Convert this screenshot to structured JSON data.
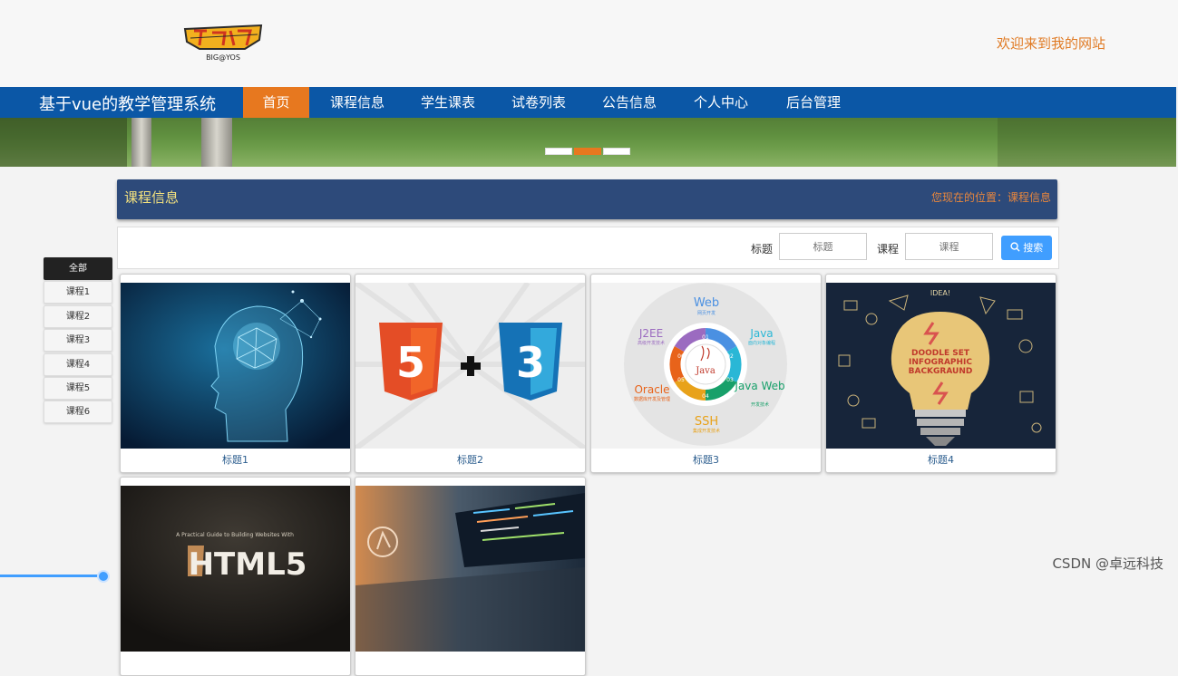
{
  "header": {
    "logo_text": "BIG@YOS",
    "welcome": "欢迎来到我的网站"
  },
  "navbar": {
    "site_title": "基于vue的教学管理系统",
    "items": [
      "首页",
      "课程信息",
      "学生课表",
      "试卷列表",
      "公告信息",
      "个人中心",
      "后台管理"
    ],
    "active_index": 0
  },
  "banner": {
    "slide_count": 3,
    "active_slide": 2
  },
  "panel": {
    "title": "课程信息",
    "breadcrumb": "您现在的位置：课程信息"
  },
  "search": {
    "title_label": "标题",
    "title_placeholder": "标题",
    "course_label": "课程",
    "course_placeholder": "课程",
    "button_label": "搜索"
  },
  "categories": [
    "全部",
    "课程1",
    "课程2",
    "课程3",
    "课程4",
    "课程5",
    "课程6"
  ],
  "cards": [
    {
      "caption": "标题1",
      "image": "ai-brain-head"
    },
    {
      "caption": "标题2",
      "image": "html5-plus-css3"
    },
    {
      "caption": "标题3",
      "image": "java-wheel"
    },
    {
      "caption": "标题4",
      "image": "lightbulb-infographic"
    },
    {
      "caption": "",
      "image": "html5-book"
    },
    {
      "caption": "",
      "image": "laptop-code"
    }
  ],
  "card_texts": {
    "doodle": [
      "DOODLE SET",
      "INFOGRAPHIC",
      "BACKGRAUND"
    ],
    "idea": "IDEA!",
    "book_subtitle": "A Practical Guide to Building Websites With",
    "book_title": "HTML5",
    "java_center": "Java",
    "wheel_segments": [
      {
        "num": "01",
        "title": "Web",
        "sub": "网页开发"
      },
      {
        "num": "02",
        "title": "Java",
        "sub": "面向对象编程"
      },
      {
        "num": "03",
        "title": "Java Web",
        "sub": "开发技术"
      },
      {
        "num": "04",
        "title": "SSH",
        "sub": "集成开发技术"
      },
      {
        "num": "05",
        "title": "Oracle",
        "sub": "数据库开发及管理"
      },
      {
        "num": "06",
        "title": "J2EE",
        "sub": "高级开发技术"
      }
    ]
  },
  "watermark": "CSDN @卓远科技",
  "colors": {
    "nav_bg": "#0b57a6",
    "accent_orange": "#e7781f",
    "panel_bg": "#2d4a7a",
    "panel_title": "#f4e27e",
    "search_button": "#409eff"
  }
}
